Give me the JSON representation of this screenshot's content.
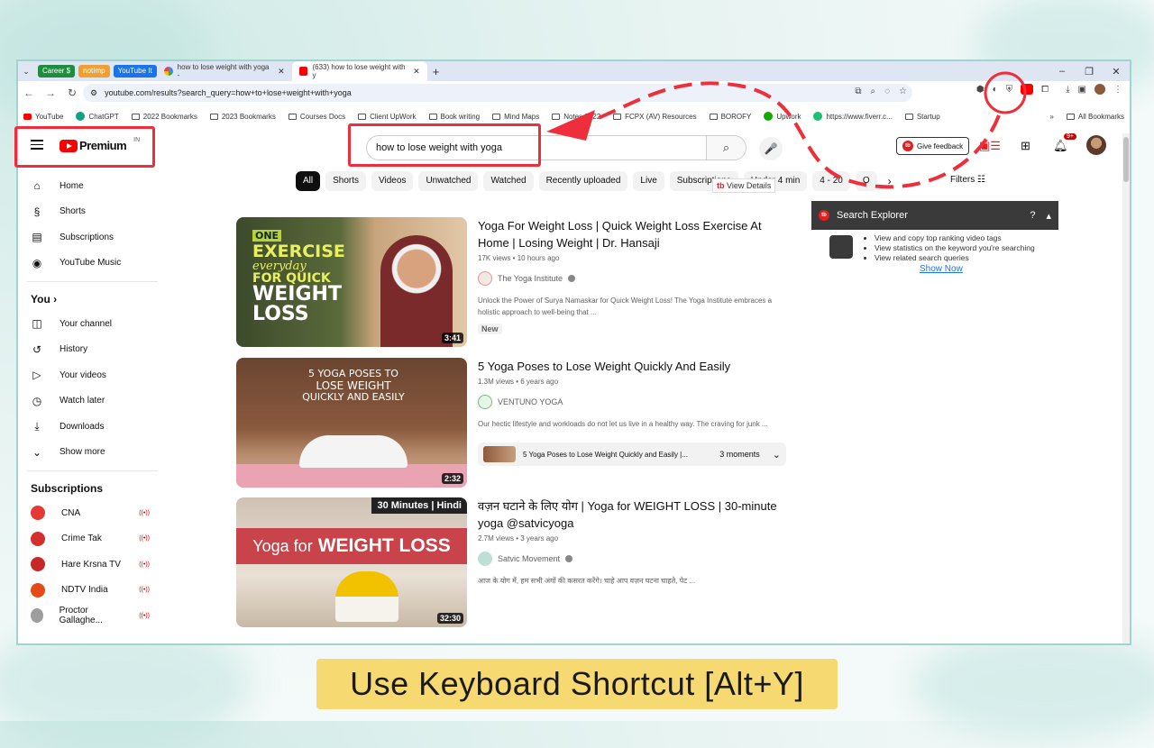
{
  "browser": {
    "tab_groups": [
      {
        "label": "Career $",
        "color": "#1e8e3e"
      },
      {
        "label": "notImp",
        "color": "#f0a030"
      },
      {
        "label": "YouTube It",
        "color": "#1a73e8"
      }
    ],
    "tabs": [
      {
        "label": "how to lose weight with yoga -"
      },
      {
        "label": "(633) how to lose weight with y"
      }
    ],
    "url": "youtube.com/results?search_query=how+to+lose+weight+with+yoga",
    "bookmarks": [
      "YouTube",
      "ChatGPT",
      "2022 Bookmarks",
      "2023 Bookmarks",
      "Courses Docs",
      "Client UpWork",
      "Book writing",
      "Mind Maps",
      "Notes 2022",
      "FCPX (AV) Resources",
      "BOROFY",
      "Upwork",
      "https://www.fiverr.c...",
      "Startup"
    ],
    "all_bookmarks": "All Bookmarks"
  },
  "youtube": {
    "logo_text": "Premium",
    "region": "IN",
    "search_value": "how to lose weight with yoga",
    "feedback_label": "Give feedback",
    "notif_count": "9+",
    "chips": [
      "All",
      "Shorts",
      "Videos",
      "Unwatched",
      "Watched",
      "Recently uploaded",
      "Live",
      "Subscriptions",
      "Under 4 min",
      "4 - 20",
      "O"
    ],
    "filters_label": "Filters",
    "view_details": "View Details",
    "sidebar": {
      "main": [
        "Home",
        "Shorts",
        "Subscriptions",
        "YouTube Music"
      ],
      "you_label": "You",
      "you": [
        "Your channel",
        "History",
        "Your videos",
        "Watch later",
        "Downloads",
        "Show more"
      ],
      "subs_label": "Subscriptions",
      "subs": [
        {
          "name": "CNA",
          "color": "#e53935"
        },
        {
          "name": "Crime Tak",
          "color": "#d32f2f"
        },
        {
          "name": "Hare Krsna TV",
          "color": "#c62828"
        },
        {
          "name": "NDTV India",
          "color": "#e64a19"
        },
        {
          "name": "Proctor Gallaghe...",
          "color": "#9e9e9e"
        }
      ]
    },
    "results": [
      {
        "title": "Yoga For Weight Loss | Quick Weight Loss Exercise At Home | Losing Weight | Dr. Hansaji",
        "meta": "17K views • 10 hours ago",
        "channel": "The Yoga Institute",
        "desc": "Unlock the Power of Surya Namaskar for Quick Weight Loss! The Yoga Institute embraces a holistic approach to well-being that ...",
        "badge": "New",
        "duration": "3:41",
        "thumb_text": [
          "ONE",
          "EXERCISE",
          "everyday",
          "FOR QUICK",
          "WEIGHT",
          "LOSS"
        ]
      },
      {
        "title": "5 Yoga Poses to Lose Weight Quickly And Easily",
        "meta": "1.3M views • 6 years ago",
        "channel": "VENTUNO YOGA",
        "desc": "Our hectic lifestyle and workloads do not let us live in a healthy way. The craving for junk ...",
        "moment_title": "5 Yoga Poses to Lose Weight Quickly and Easily |...",
        "moment_count": "3 moments",
        "duration": "2:32",
        "thumb_text": [
          "5 YOGA POSES TO",
          "LOSE WEIGHT",
          "QUICKLY AND EASILY"
        ]
      },
      {
        "title": "वज़न घटाने के लिए योग | Yoga for WEIGHT LOSS | 30-minute yoga @satvicyoga",
        "meta": "2.7M views • 3 years ago",
        "channel": "Satvic Movement",
        "desc": "आज के योग में, हम सभी अंगों की कसरत करेंगे। चाहे आप वज़न घटना चाहते, पेट ...",
        "duration": "32:30",
        "thumb_text": [
          "30 Minutes | Hindi",
          "Yoga for",
          "WEIGHT LOSS"
        ]
      }
    ],
    "search_explorer": {
      "title": "Search Explorer",
      "items": [
        "View and copy top ranking video tags",
        "View statistics on the keyword you're searching",
        "View related search queries"
      ],
      "show_now": "Show Now"
    }
  },
  "caption": "Use Keyboard Shortcut [Alt+Y]"
}
